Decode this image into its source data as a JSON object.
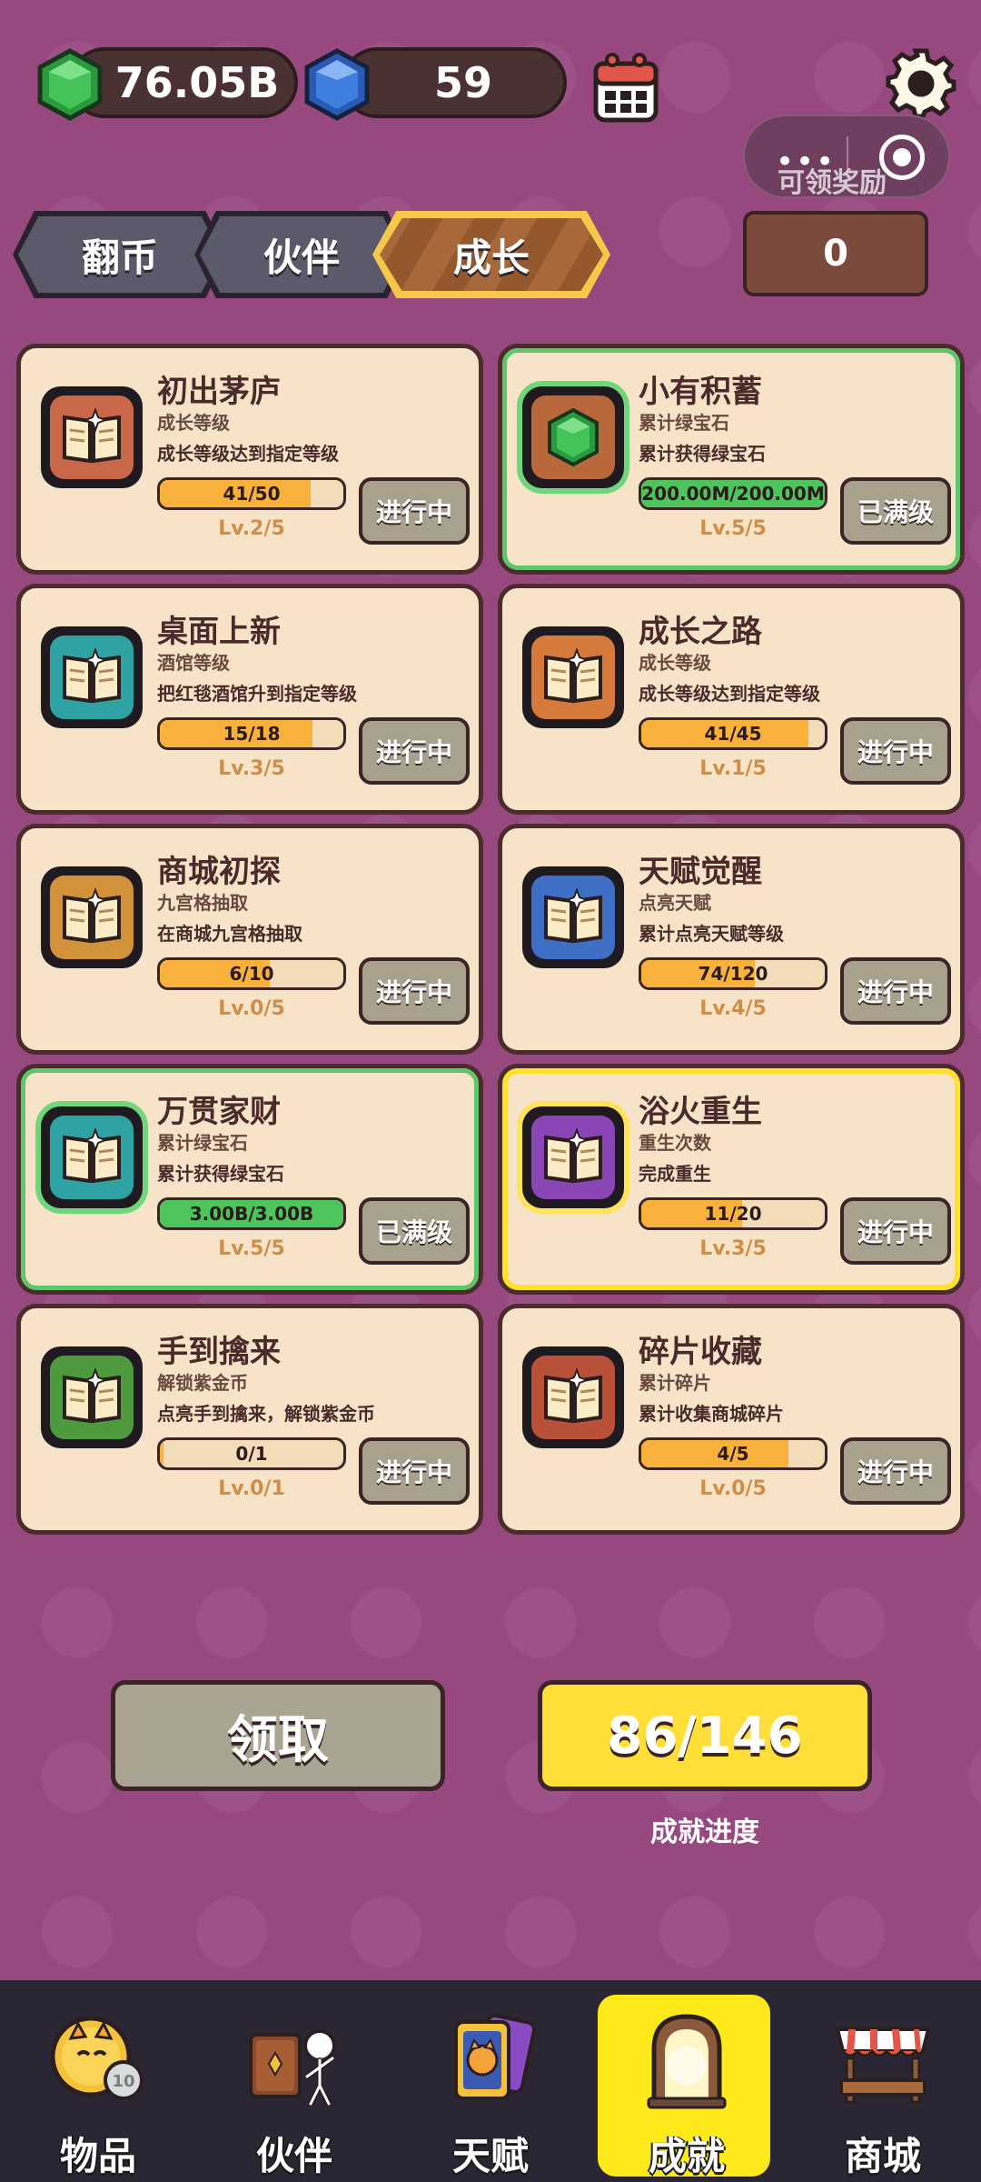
{
  "currency": {
    "emerald_value": "76.05B",
    "sapphire_value": "59"
  },
  "top_right": {
    "reward_label": "可领奖励"
  },
  "tabs": [
    {
      "label": "翻币",
      "active": false
    },
    {
      "label": "伙伴",
      "active": false
    },
    {
      "label": "成长",
      "active": true
    }
  ],
  "counter_value": "0",
  "cards": [
    {
      "title": "初出茅庐",
      "sub": "成长等级",
      "desc": "成长等级达到指定等级",
      "progress_text": "41/50",
      "progress": 0.82,
      "level": "Lv.2/5",
      "button": "进行中",
      "icon_color": "#c8674a",
      "state": "normal"
    },
    {
      "title": "小有积蓄",
      "sub": "累计绿宝石",
      "desc": "累计获得绿宝石",
      "progress_text": "200.00M/200.00M",
      "progress": 1.0,
      "level": "Lv.5/5",
      "button": "已满级",
      "icon_color": "#b8683a",
      "state": "done"
    },
    {
      "title": "桌面上新",
      "sub": "酒馆等级",
      "desc": "把红毯酒馆升到指定等级",
      "progress_text": "15/18",
      "progress": 0.83,
      "level": "Lv.3/5",
      "button": "进行中",
      "icon_color": "#2fa3a4",
      "state": "normal"
    },
    {
      "title": "成长之路",
      "sub": "成长等级",
      "desc": "成长等级达到指定等级",
      "progress_text": "41/45",
      "progress": 0.91,
      "level": "Lv.1/5",
      "button": "进行中",
      "icon_color": "#d57a3a",
      "state": "normal"
    },
    {
      "title": "商城初探",
      "sub": "九宫格抽取",
      "desc": "在商城九宫格抽取",
      "progress_text": "6/10",
      "progress": 0.6,
      "level": "Lv.0/5",
      "button": "进行中",
      "icon_color": "#d2923a",
      "state": "normal"
    },
    {
      "title": "天赋觉醒",
      "sub": "点亮天赋",
      "desc": "累计点亮天赋等级",
      "progress_text": "74/120",
      "progress": 0.62,
      "level": "Lv.4/5",
      "button": "进行中",
      "icon_color": "#3f6fc4",
      "state": "normal"
    },
    {
      "title": "万贯家财",
      "sub": "累计绿宝石",
      "desc": "累计获得绿宝石",
      "progress_text": "3.00B/3.00B",
      "progress": 1.0,
      "level": "Lv.5/5",
      "button": "已满级",
      "icon_color": "#2fa3a4",
      "state": "done"
    },
    {
      "title": "浴火重生",
      "sub": "重生次数",
      "desc": "完成重生",
      "progress_text": "11/20",
      "progress": 0.55,
      "level": "Lv.3/5",
      "button": "进行中",
      "icon_color": "#8a46b4",
      "state": "highlight"
    },
    {
      "title": "手到擒来",
      "sub": "解锁紫金币",
      "desc": "点亮手到擒来，解锁紫金币",
      "progress_text": "0/1",
      "progress": 0.02,
      "level": "Lv.0/1",
      "button": "进行中",
      "icon_color": "#4f9a3e",
      "state": "normal"
    },
    {
      "title": "碎片收藏",
      "sub": "累计碎片",
      "desc": "累计收集商城碎片",
      "progress_text": "4/5",
      "progress": 0.8,
      "level": "Lv.0/5",
      "button": "进行中",
      "icon_color": "#b8503a",
      "state": "normal"
    }
  ],
  "bottom": {
    "claim_label": "领取",
    "progress_value": "86/146",
    "progress_caption": "成就进度"
  },
  "nav": [
    {
      "label": "物品",
      "icon": "cat-coin-icon",
      "active": false
    },
    {
      "label": "伙伴",
      "icon": "partner-book-icon",
      "active": false
    },
    {
      "label": "天赋",
      "icon": "talent-card-icon",
      "active": false
    },
    {
      "label": "成就",
      "icon": "achievement-gate-icon",
      "active": true
    },
    {
      "label": "商城",
      "icon": "shop-stall-icon",
      "active": false
    }
  ],
  "colors": {
    "background": "#97497f",
    "card_bg": "#f6e3c8",
    "progress_orange": "#f8b23c",
    "progress_green": "#4ec45c",
    "active_nav": "#fee91b",
    "tab_active_border": "#f6c84a"
  }
}
